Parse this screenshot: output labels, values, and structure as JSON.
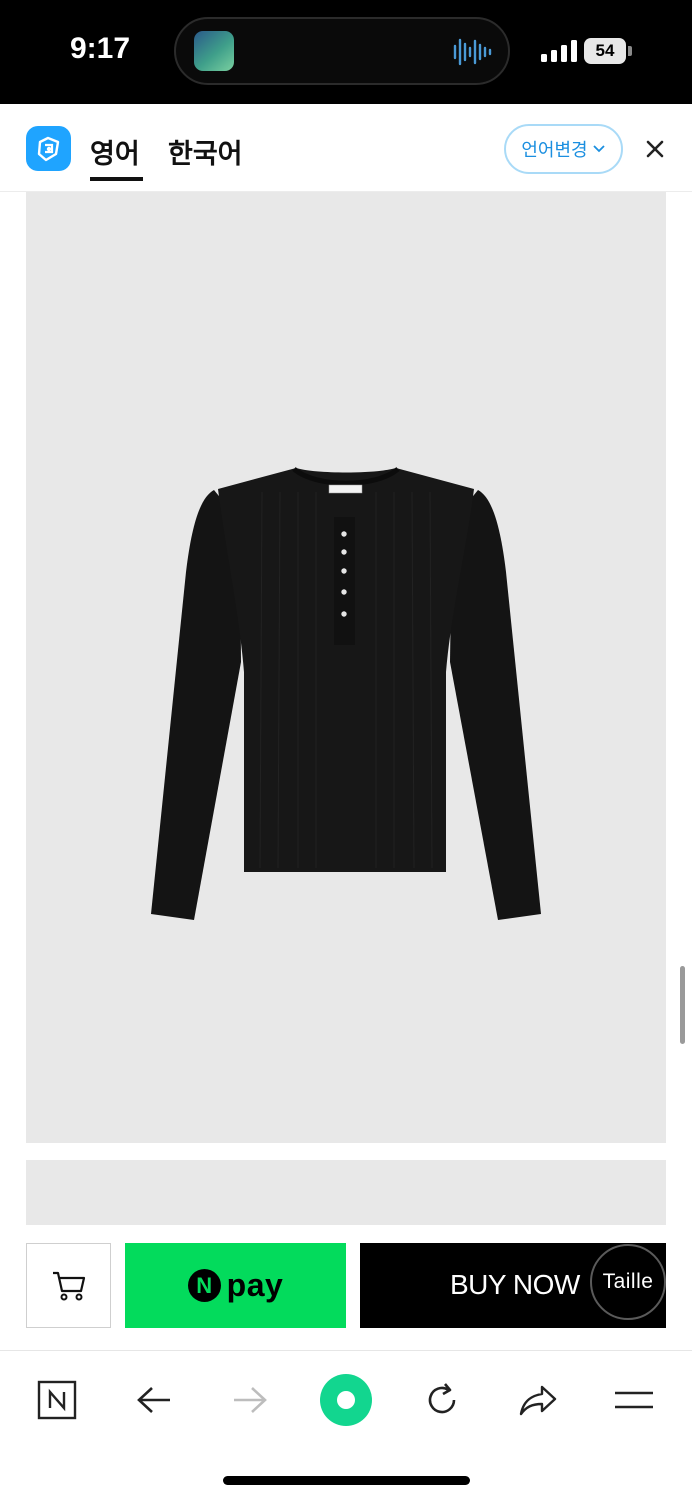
{
  "status_bar": {
    "time": "9:17",
    "battery": "54"
  },
  "translate_bar": {
    "tabs": [
      {
        "label": "영어",
        "active": true
      },
      {
        "label": "한국어",
        "active": false
      }
    ],
    "language_button": "언어변경",
    "accent_color": "#1b8fe0"
  },
  "product": {
    "background_color": "#e8e8e8",
    "garment_label": "Taille"
  },
  "purchase_bar": {
    "npay_logo_letter": "N",
    "npay_label": "pay",
    "npay_color": "#03db5c",
    "buy_now_label": "BUY NOW",
    "floating_label": "Taille"
  },
  "browser_toolbar": {
    "items": [
      "naver-icon",
      "back-arrow-icon",
      "forward-arrow-icon",
      "green-dot-icon",
      "refresh-icon",
      "share-icon",
      "menu-icon"
    ]
  }
}
